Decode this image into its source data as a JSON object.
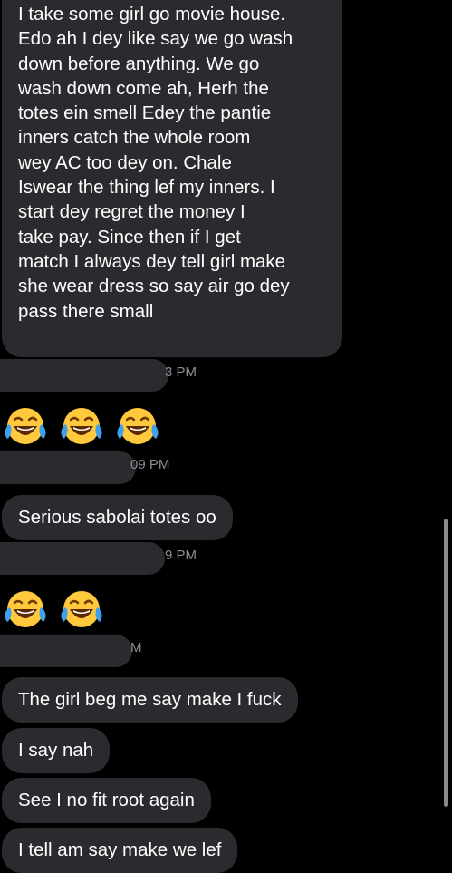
{
  "messages": {
    "long_message": [
      "I take some girl go movie house.",
      "Edo ah I dey like say we go wash",
      "down before anything. We go",
      "wash down come ah, Herh the",
      "totes ein smell Edey the pantie",
      "inners catch the whole room",
      "wey AC too dey on. Chale",
      "Iswear the thing lef my inners. I",
      "start dey regret the money I",
      "take pay. Since then if I get",
      "match I always dey tell girl make",
      "she wear dress so say air go dey",
      "pass there small"
    ],
    "serious": "Serious sabolai totes oo",
    "girl_beg": "The girl beg me say make I fuck",
    "i_say_nah": "I say nah",
    "see_i_no_fit": "See I no fit root again",
    "i_tell_am": "I tell am say make we lef"
  },
  "timestamps": {
    "t1": "3 PM",
    "t2": "09 PM",
    "t3": "9 PM",
    "t4": "M"
  },
  "reactions": {
    "emoji_name": "face-with-tears-of-joy",
    "row1_count": 3,
    "row2_count": 2
  },
  "colors": {
    "background": "#000000",
    "bubble": "#2a2b2e",
    "text": "#ffffff",
    "timestamp": "#8e8e93",
    "emoji_face": "#ffc83d",
    "emoji_tears": "#3ea0ee"
  }
}
